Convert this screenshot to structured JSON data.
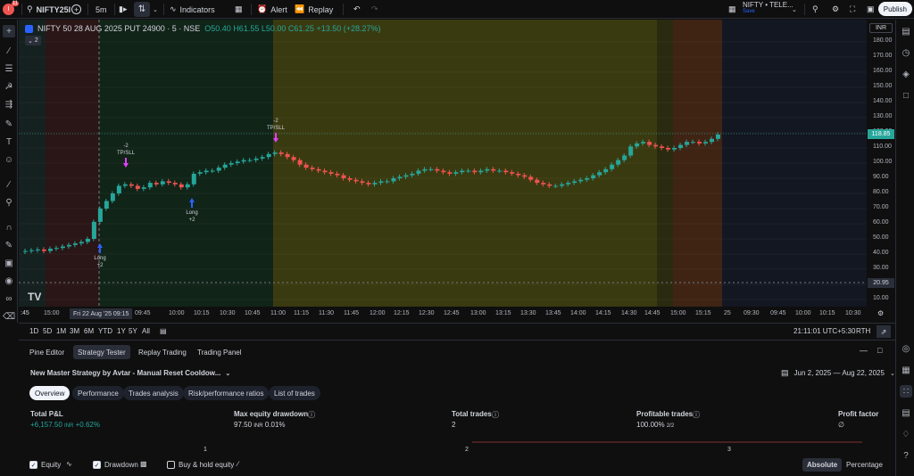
{
  "topbar": {
    "notification_count": "11",
    "symbol": "NIFTY25I",
    "interval": "5m",
    "indicators_label": "Indicators",
    "alert_label": "Alert",
    "replay_label": "Replay",
    "watchlist_name": "NIFTY • TELE...",
    "watchlist_status": "Save",
    "publish_label": "Publish"
  },
  "legend": {
    "title": "NIFTY 50 28 AUG 2025 PUT 24900 · 5 · NSE",
    "open": "O50.40",
    "high": "H61.55",
    "low": "L50.00",
    "close": "C61.25",
    "change": "+13.50 (+28.27%)",
    "collapse_count": "2"
  },
  "price_axis": {
    "currency": "INR",
    "labels": [
      "180.00",
      "170.00",
      "160.00",
      "150.00",
      "140.00",
      "130.00",
      "120.00",
      "110.00",
      "100.00",
      "90.00",
      "80.00",
      "70.00",
      "60.00",
      "50.00",
      "40.00",
      "30.00",
      "20.00",
      "10.00"
    ],
    "current_price": "118.85",
    "bottom_price": "20.95"
  },
  "time_axis": {
    "labels": [
      "15:00",
      "09:45",
      "10:00",
      "10:15",
      "10:30",
      "10:45",
      "11:00",
      "11:15",
      "11:30",
      "11:45",
      "12:00",
      "12:15",
      "12:30",
      "12:45",
      "13:00",
      "13:15",
      "13:30",
      "13:45",
      "14:00",
      "14:15",
      "14:30",
      "14:45",
      "15:00",
      "15:15",
      "25",
      "09:30",
      "09:45",
      "10:00",
      "10:15",
      "10:30"
    ],
    "crosshair_label": "Fri 22 Aug '25  09:15",
    "left_edge": ":45"
  },
  "annotations": {
    "long1": "Long",
    "long1_qty": "+2",
    "tp1_qty": "-2",
    "tp1": "TP/SLL",
    "long2": "Long",
    "long2_qty": "+2",
    "tp2_qty": "-2",
    "tp2": "TP/SLL"
  },
  "range_bar": {
    "ranges": [
      "1D",
      "5D",
      "1M",
      "3M",
      "6M",
      "YTD",
      "1Y",
      "5Y",
      "All"
    ],
    "clock": "21:11:01 UTC+5:30",
    "rth": "RTH"
  },
  "panel": {
    "tabs": [
      "Pine Editor",
      "Strategy Tester",
      "Replay Trading",
      "Trading Panel"
    ],
    "strategy_name": "New Master Strategy by Avtar - Manual Reset Cooldow...",
    "date_range": "Jun 2, 2025 — Aug 22, 2025",
    "pills": [
      "Overview",
      "Performance",
      "Trades analysis",
      "Risk/performance ratios",
      "List of trades"
    ],
    "metrics": {
      "total_pl_label": "Total P&L",
      "total_pl_value": "+6,157.50",
      "total_pl_unit": "INR",
      "total_pl_pct": "+0.62%",
      "max_dd_label": "Max equity drawdown",
      "max_dd_value": "97.50",
      "max_dd_unit": "INR",
      "max_dd_pct": "0.01%",
      "total_trades_label": "Total trades",
      "total_trades_value": "2",
      "profitable_label": "Profitable trades",
      "profitable_value": "100.00%",
      "profitable_ratio": "2/2",
      "profit_factor_label": "Profit factor",
      "profit_factor_value": "∅"
    },
    "mini_axis": [
      "1",
      "2",
      "3"
    ],
    "checkboxes": {
      "equity": "Equity",
      "drawdown": "Drawdown",
      "buy_hold": "Buy & hold equity"
    },
    "absolute": "Absolute",
    "percentage": "Percentage"
  },
  "colors": {
    "bull": "#26a69a",
    "bear": "#ef5350",
    "accent": "#2962ff"
  },
  "chart_data": {
    "type": "candlestick",
    "currency": "INR",
    "ylim": [
      10,
      190
    ],
    "candles_close_sequence": [
      42,
      42.5,
      43,
      42,
      43.5,
      44,
      45,
      46,
      47,
      48,
      50,
      61.25,
      70,
      75,
      80,
      85,
      86,
      85,
      83,
      84,
      87,
      86,
      88,
      87,
      86,
      84,
      86,
      93,
      94,
      95,
      95,
      97,
      99,
      100,
      101,
      102,
      102,
      103,
      104,
      106,
      107,
      106,
      104,
      102,
      99,
      97,
      96,
      95,
      94,
      93,
      92,
      90,
      89,
      88,
      87,
      86,
      87,
      88,
      88,
      90,
      91,
      92,
      93,
      95,
      96,
      96,
      95,
      94,
      93,
      94,
      95,
      95,
      94,
      95,
      96,
      95,
      95,
      94,
      93,
      92,
      91,
      89,
      87,
      86,
      85,
      85,
      86,
      87,
      88,
      89,
      90,
      92,
      94,
      96,
      99,
      102,
      105,
      111,
      113,
      114,
      112,
      111,
      110,
      109,
      110,
      112,
      114,
      114,
      113,
      114,
      116,
      118.85
    ]
  }
}
